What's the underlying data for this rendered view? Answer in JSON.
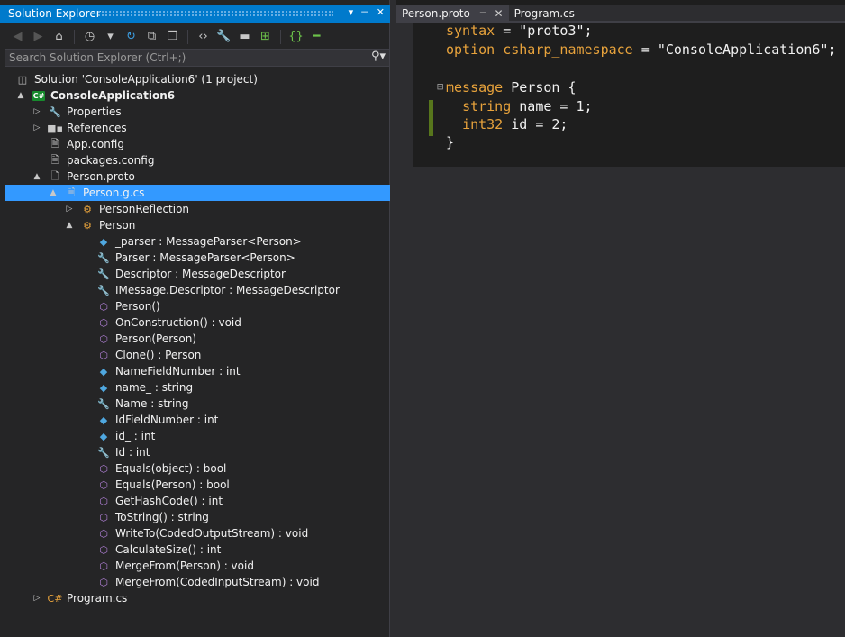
{
  "solution_explorer": {
    "title": "Solution Explorer",
    "pin_button": "▾",
    "pin2_button": "⊣",
    "close_button": "✕",
    "search_placeholder": "Search Solution Explorer (Ctrl+;)",
    "tree": [
      {
        "label": "Solution 'ConsoleApplication6' (1 project)",
        "icon": "solution-icon",
        "expander": "",
        "bold": false
      },
      {
        "label": "ConsoleApplication6",
        "icon": "csharp-project-icon",
        "expander": "▲",
        "bold": true
      },
      {
        "label": "Properties",
        "icon": "wrench-icon",
        "expander": "▷",
        "bold": false
      },
      {
        "label": "References",
        "icon": "references-icon",
        "expander": "▷",
        "bold": false
      },
      {
        "label": "App.config",
        "icon": "config-file-icon",
        "expander": "",
        "bold": false
      },
      {
        "label": "packages.config",
        "icon": "config-file-icon",
        "expander": "",
        "bold": false
      },
      {
        "label": "Person.proto",
        "icon": "file-icon",
        "expander": "▲",
        "bold": false
      },
      {
        "label": "Person.g.cs",
        "icon": "cs-file-icon",
        "expander": "▲",
        "bold": false,
        "selected": true
      },
      {
        "label": "PersonReflection",
        "icon": "class-icon",
        "expander": "▷",
        "bold": false
      },
      {
        "label": "Person",
        "icon": "class-icon",
        "expander": "▲",
        "bold": false
      },
      {
        "label": "_parser : MessageParser<Person>",
        "icon": "private-field-icon",
        "expander": "",
        "bold": false
      },
      {
        "label": "Parser : MessageParser<Person>",
        "icon": "property-icon",
        "expander": "",
        "bold": false
      },
      {
        "label": "Descriptor : MessageDescriptor",
        "icon": "property-icon",
        "expander": "",
        "bold": false
      },
      {
        "label": "IMessage.Descriptor : MessageDescriptor",
        "icon": "private-property-icon",
        "expander": "",
        "bold": false
      },
      {
        "label": "Person()",
        "icon": "method-icon",
        "expander": "",
        "bold": false
      },
      {
        "label": "OnConstruction() : void",
        "icon": "private-method-icon",
        "expander": "",
        "bold": false
      },
      {
        "label": "Person(Person)",
        "icon": "method-icon",
        "expander": "",
        "bold": false
      },
      {
        "label": "Clone() : Person",
        "icon": "method-icon",
        "expander": "",
        "bold": false
      },
      {
        "label": "NameFieldNumber : int",
        "icon": "field-icon",
        "expander": "",
        "bold": false
      },
      {
        "label": "name_ : string",
        "icon": "private-field-icon",
        "expander": "",
        "bold": false
      },
      {
        "label": "Name : string",
        "icon": "property-icon",
        "expander": "",
        "bold": false
      },
      {
        "label": "IdFieldNumber : int",
        "icon": "field-icon",
        "expander": "",
        "bold": false
      },
      {
        "label": "id_ : int",
        "icon": "private-field-icon",
        "expander": "",
        "bold": false
      },
      {
        "label": "Id : int",
        "icon": "property-icon",
        "expander": "",
        "bold": false
      },
      {
        "label": "Equals(object) : bool",
        "icon": "method-icon",
        "expander": "",
        "bold": false
      },
      {
        "label": "Equals(Person) : bool",
        "icon": "method-icon",
        "expander": "",
        "bold": false
      },
      {
        "label": "GetHashCode() : int",
        "icon": "method-icon",
        "expander": "",
        "bold": false
      },
      {
        "label": "ToString() : string",
        "icon": "method-icon",
        "expander": "",
        "bold": false
      },
      {
        "label": "WriteTo(CodedOutputStream) : void",
        "icon": "method-icon",
        "expander": "",
        "bold": false
      },
      {
        "label": "CalculateSize() : int",
        "icon": "method-icon",
        "expander": "",
        "bold": false
      },
      {
        "label": "MergeFrom(Person) : void",
        "icon": "method-icon",
        "expander": "",
        "bold": false
      },
      {
        "label": "MergeFrom(CodedInputStream) : void",
        "icon": "method-icon",
        "expander": "",
        "bold": false
      },
      {
        "label": "Program.cs",
        "icon": "cs-class-file-icon",
        "expander": "▷",
        "bold": false
      }
    ]
  },
  "editor": {
    "tabs": [
      {
        "label": "Person.proto",
        "active": true,
        "pin": "⊣",
        "close": "✕"
      },
      {
        "label": "Program.cs",
        "active": false
      }
    ],
    "code_lines": [
      [
        {
          "t": "syntax",
          "c": "kw"
        },
        {
          "t": " = ",
          "c": "pl"
        },
        {
          "t": "\"proto3\"",
          "c": "str"
        },
        {
          "t": ";",
          "c": "pl"
        }
      ],
      [
        {
          "t": "option",
          "c": "kw"
        },
        {
          "t": " ",
          "c": "pl"
        },
        {
          "t": "csharp_namespace",
          "c": "kw"
        },
        {
          "t": " = ",
          "c": "pl"
        },
        {
          "t": "\"ConsoleApplication6\"",
          "c": "str"
        },
        {
          "t": ";",
          "c": "pl"
        }
      ],
      [],
      [
        {
          "t": "message",
          "c": "kw"
        },
        {
          "t": " Person {",
          "c": "pl"
        }
      ],
      [
        {
          "t": "  ",
          "c": "pl"
        },
        {
          "t": "string",
          "c": "ty"
        },
        {
          "t": " name = 1;",
          "c": "pl"
        }
      ],
      [
        {
          "t": "  ",
          "c": "pl"
        },
        {
          "t": "int32",
          "c": "ty"
        },
        {
          "t": " id = 2;",
          "c": "pl"
        }
      ],
      [
        {
          "t": "}",
          "c": "pl"
        }
      ]
    ]
  },
  "colors": {
    "accent": "#007acc",
    "selection": "#3399ff",
    "keyword": "#e8a33c",
    "change_marker": "#57761c"
  }
}
